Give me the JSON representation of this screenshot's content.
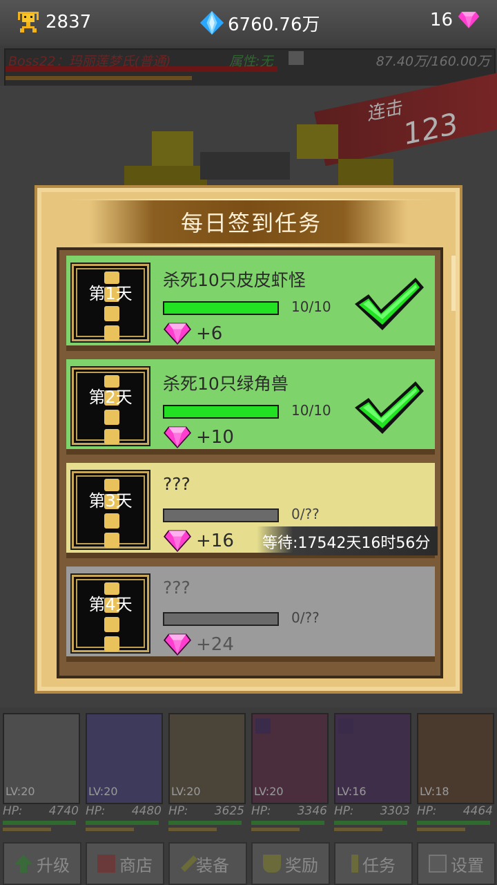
{
  "topbar": {
    "gold": "2837",
    "diamonds": "6760.76万",
    "gems": "16",
    "gold_icon": "trophy-icon",
    "diamond_icon": "blue-diamond-icon",
    "gem_icon": "pink-gem-icon"
  },
  "boss": {
    "name": "Boss22：玛丽莲梦氏(普通)",
    "attribute": "属性:无",
    "hp": "87.40万/160.00万",
    "hp_fraction": 0.546
  },
  "combo": {
    "label": "连击",
    "count": "123"
  },
  "dialog": {
    "title": "每日签到任务",
    "tasks": [
      {
        "day": "第1天",
        "name": "杀死10只皮皮虾怪",
        "progress": "10/10",
        "progress_fraction": 1.0,
        "reward": "+6",
        "state": "done"
      },
      {
        "day": "第2天",
        "name": "杀死10只绿角兽",
        "progress": "10/10",
        "progress_fraction": 1.0,
        "reward": "+10",
        "state": "done"
      },
      {
        "day": "第3天",
        "name": "???",
        "progress": "0/??",
        "progress_fraction": 0.0,
        "reward": "+16",
        "state": "waiting",
        "wait_text": "等待:17542天16时56分"
      },
      {
        "day": "第4天",
        "name": "???",
        "progress": "0/??",
        "progress_fraction": 0.0,
        "reward": "+24",
        "state": "locked"
      }
    ]
  },
  "heroes": [
    {
      "lv": "LV:20",
      "hp_label": "HP:",
      "hp": "4740"
    },
    {
      "lv": "LV:20",
      "hp_label": "HP:",
      "hp": "4480"
    },
    {
      "lv": "LV:20",
      "hp_label": "HP:",
      "hp": "3625"
    },
    {
      "lv": "LV:20",
      "hp_label": "HP:",
      "hp": "3346"
    },
    {
      "lv": "LV:16",
      "hp_label": "HP:",
      "hp": "3303"
    },
    {
      "lv": "LV:18",
      "hp_label": "HP:",
      "hp": "4464"
    }
  ],
  "menu": [
    {
      "label": "升级",
      "icon": "up-arrow-icon"
    },
    {
      "label": "商店",
      "icon": "shop-icon"
    },
    {
      "label": "装备",
      "icon": "sword-icon"
    },
    {
      "label": "奖励",
      "icon": "trophy-icon"
    },
    {
      "label": "任务",
      "icon": "exclamation-icon"
    },
    {
      "label": "设置",
      "icon": "settings-icon"
    }
  ],
  "colors": {
    "task_done": "#7ed36a",
    "task_waiting": "#e6de8e",
    "task_locked": "#9b9b9b",
    "progress_fill": "#22e022",
    "gem_pink": "#ff5ad2"
  }
}
